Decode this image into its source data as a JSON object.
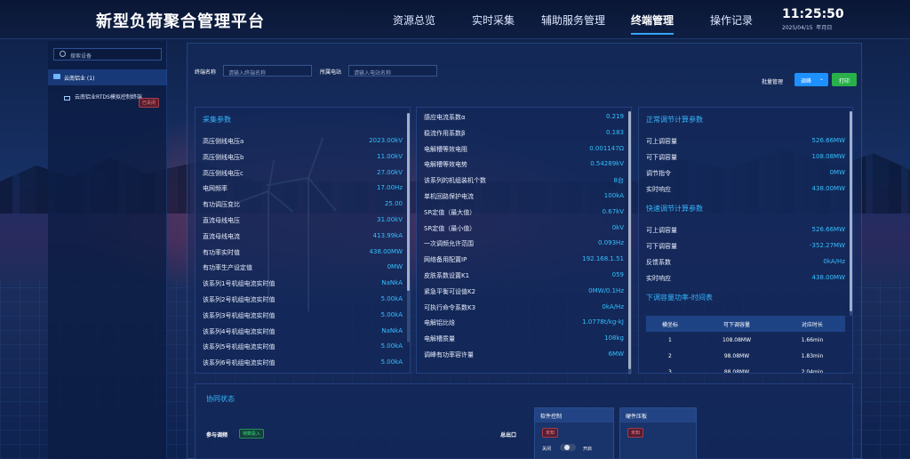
{
  "header": {
    "title": "新型负荷聚合管理平台",
    "nav": [
      "资源总览",
      "实时采集",
      "辅助服务管理",
      "终端管理",
      "操作记录"
    ],
    "active_nav": "终端管理",
    "time": "11:25:50",
    "date": "2025/04/15",
    "weekday": "年月日"
  },
  "sidebar": {
    "search_placeholder": "搜索设备",
    "root_label": "云南铝业 (1)",
    "child_label": "云南铝业RTDS模拟控制终端",
    "child_status": "已关闭"
  },
  "filters": {
    "terminal_label": "终端名称",
    "terminal_placeholder": "请输入终端名称",
    "station_label": "所属电站",
    "station_placeholder": "请输入电站名称",
    "batch_label": "批量管理",
    "adjust_button": "调峰",
    "print_button": "打印"
  },
  "collect": {
    "title": "采集参数",
    "rows": [
      {
        "k": "高压侧线电压a",
        "v": "2023.00kV"
      },
      {
        "k": "高压侧线电压b",
        "v": "11.00kV"
      },
      {
        "k": "高压侧线电压c",
        "v": "27.00kV"
      },
      {
        "k": "电网频率",
        "v": "17.00Hz"
      },
      {
        "k": "有功调压变比",
        "v": "25.00"
      },
      {
        "k": "直流母线电压",
        "v": "31.00kV"
      },
      {
        "k": "直流母线电流",
        "v": "413.99kA"
      },
      {
        "k": "有功率实时值",
        "v": "438.00MW"
      },
      {
        "k": "有功率生产设定值",
        "v": "0MW"
      },
      {
        "k": "该系列1号机组电流实时值",
        "v": "NaNkA"
      },
      {
        "k": "该系列2号机组电流实时值",
        "v": "5.00kA"
      },
      {
        "k": "该系列3号机组电流实时值",
        "v": "5.00kA"
      },
      {
        "k": "该系列4号机组电流实时值",
        "v": "NaNkA"
      },
      {
        "k": "该系列5号机组电流实时值",
        "v": "5.00kA"
      },
      {
        "k": "该系列6号机组电流实时值",
        "v": "5.00kA"
      }
    ]
  },
  "params": {
    "rows": [
      {
        "k": "感应电流系数α",
        "v": "0.219"
      },
      {
        "k": "稳流作用系数β",
        "v": "0.183"
      },
      {
        "k": "电解槽等效电阻",
        "v": "0.001147Ω"
      },
      {
        "k": "电解槽等效电势",
        "v": "0.54289kV"
      },
      {
        "k": "该系列的机组装机个数",
        "v": "8台"
      },
      {
        "k": "单机回路保护电流",
        "v": "100kA"
      },
      {
        "k": "SR定值（最大值）",
        "v": "0.67kV"
      },
      {
        "k": "SR定值（最小值）",
        "v": "0kV"
      },
      {
        "k": "一次调频允许范围",
        "v": "0.093Hz"
      },
      {
        "k": "网络备用配置IP",
        "v": "192.168.1.51"
      },
      {
        "k": "皮肤系数设置K1",
        "v": "059"
      },
      {
        "k": "紧急平衡可设值K2",
        "v": "0MW/0.1Hz"
      },
      {
        "k": "可执行命令系数K3",
        "v": "0kA/Hz"
      },
      {
        "k": "电解铝比焓",
        "v": "1.0778t/kg-kJ"
      },
      {
        "k": "电解槽质量",
        "v": "108kg"
      },
      {
        "k": "调峰有功率容许量",
        "v": "6MW"
      }
    ]
  },
  "normal_adjust": {
    "title": "正常调节计算参数",
    "rows": [
      {
        "k": "可上调容量",
        "v": "526.66MW"
      },
      {
        "k": "可下调容量",
        "v": "108.08MW"
      },
      {
        "k": "调节指令",
        "v": "0MW"
      },
      {
        "k": "实时响应",
        "v": "438.00MW"
      }
    ]
  },
  "fast_adjust": {
    "title": "快速调节计算参数",
    "rows": [
      {
        "k": "可上调容量",
        "v": "526.66MW"
      },
      {
        "k": "可下调容量",
        "v": "-352.27MW"
      },
      {
        "k": "反馈系数",
        "v": "0kA/Hz"
      },
      {
        "k": "实时响应",
        "v": "438.00MW"
      }
    ]
  },
  "down_table": {
    "title": "下调容量功率-时间表",
    "headers": [
      "横坐标",
      "可下调容量",
      "对应时长"
    ],
    "rows": [
      [
        "1",
        "108.08MW",
        "1.66min"
      ],
      [
        "2",
        "98.08MW",
        "1.83min"
      ],
      [
        "3",
        "88.08MW",
        "2.04min"
      ]
    ]
  },
  "coop": {
    "title": "协同状态",
    "participate_label": "参与调频",
    "participate_status": "待数投入",
    "outlet_label": "总出口",
    "soft_title": "软件控制",
    "soft_tag": "未知",
    "toggle_off": "关闭",
    "toggle_on": "开启",
    "hard_title": "硬件压板",
    "hard_tag": "未知"
  },
  "colors": {
    "accent": "#35b6ff",
    "value": "#34c0ff",
    "primary_button": "#1e90ff",
    "print_button": "#29b04a",
    "offline": "#ff7b7b"
  }
}
